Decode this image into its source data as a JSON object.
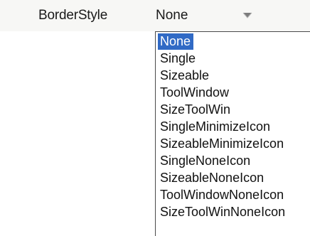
{
  "property": {
    "name": "BorderStyle",
    "value": "None"
  },
  "dropdown": {
    "selected_index": 0,
    "options": [
      "None",
      "Single",
      "Sizeable",
      "ToolWindow",
      "SizeToolWin",
      "SingleMinimizeIcon",
      "SizeableMinimizeIcon",
      "SingleNoneIcon",
      "SizeableNoneIcon",
      "ToolWindowNoneIcon",
      "SizeToolWinNoneIcon"
    ]
  },
  "icons": {
    "dropdown_button": "chevron-down-icon"
  },
  "colors": {
    "selection_background": "#316ac5",
    "selection_text": "#ffffff"
  }
}
